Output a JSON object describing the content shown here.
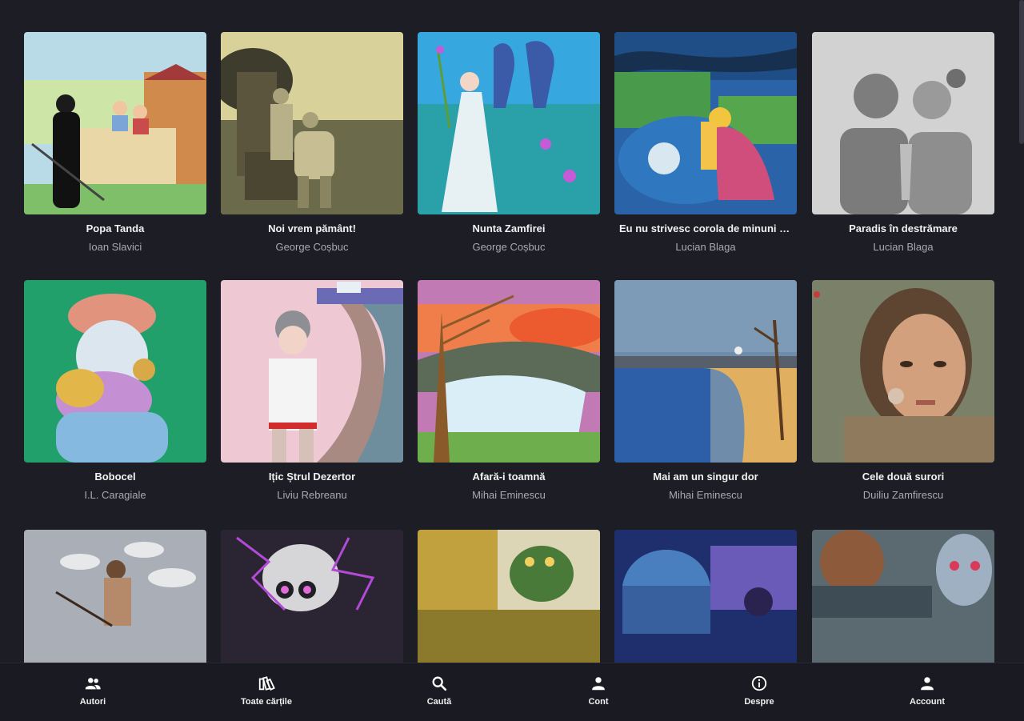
{
  "books": [
    {
      "title": "Popa Tanda",
      "author": "Ioan Slavici"
    },
    {
      "title": "Noi vrem pământ!",
      "author": "George Coșbuc"
    },
    {
      "title": "Nunta Zamfirei",
      "author": "George Coșbuc"
    },
    {
      "title": "Eu nu strivesc corola de minuni a lumii",
      "author": "Lucian Blaga"
    },
    {
      "title": "Paradis în destrămare",
      "author": "Lucian Blaga"
    },
    {
      "title": "Bobocel",
      "author": "I.L. Caragiale"
    },
    {
      "title": "Ițic Ștrul Dezertor",
      "author": "Liviu Rebreanu"
    },
    {
      "title": "Afară-i toamnă",
      "author": "Mihai Eminescu"
    },
    {
      "title": "Mai am un singur dor",
      "author": "Mihai Eminescu"
    },
    {
      "title": "Cele două surori",
      "author": "Duiliu Zamfirescu"
    }
  ],
  "nav": [
    {
      "label": "Autori",
      "icon": "people-icon"
    },
    {
      "label": "Toate cărțile",
      "icon": "books-icon"
    },
    {
      "label": "Caută",
      "icon": "search-icon"
    },
    {
      "label": "Cont",
      "icon": "person-icon"
    },
    {
      "label": "Despre",
      "icon": "info-icon"
    },
    {
      "label": "Account",
      "icon": "person-icon"
    }
  ],
  "colors": {
    "background": "#1d1d26",
    "nav_background": "#1a1a22",
    "author_text": "#a9a9b2"
  }
}
